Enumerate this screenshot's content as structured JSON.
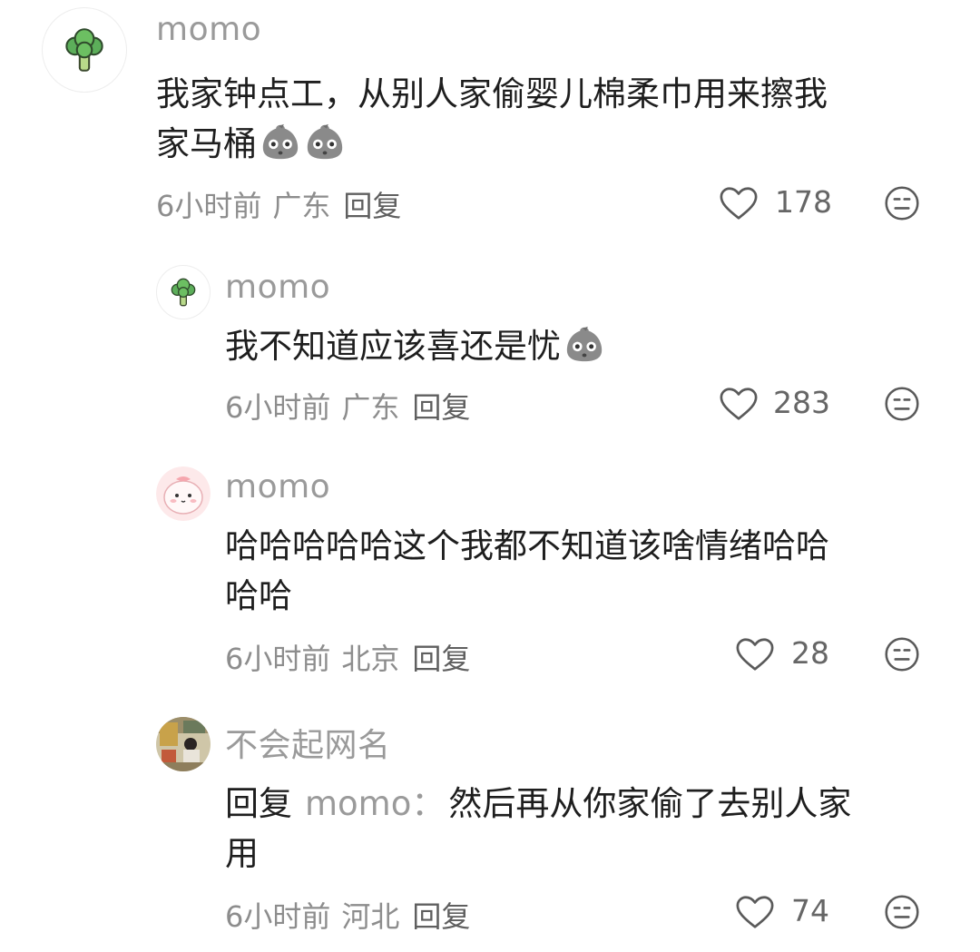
{
  "comments": [
    {
      "username": "momo",
      "avatar": "broccoli-avatar",
      "text_line1": "我家钟点工，从别人家偷婴儿棉柔巾用来擦我",
      "text_line2": "家马桶",
      "time": "6小时前",
      "location": "广东",
      "reply_label": "回复",
      "likes": "178"
    },
    {
      "username": "momo",
      "avatar": "broccoli-avatar",
      "text_line1": "我不知道应该喜还是忧",
      "time": "6小时前",
      "location": "广东",
      "reply_label": "回复",
      "likes": "283"
    },
    {
      "username": "momo",
      "avatar": "pink-character-avatar",
      "text_line1": "哈哈哈哈哈这个我都不知道该啥情绪哈哈",
      "text_line2": "哈哈",
      "time": "6小时前",
      "location": "北京",
      "reply_label": "回复",
      "likes": "28"
    },
    {
      "username": "不会起网名",
      "avatar": "photo-avatar",
      "reply_prefix": "回复",
      "reply_to": "momo：",
      "text_line1": "然后再从你家偷了去别人家",
      "text_line2": "用",
      "time": "6小时前",
      "location": "河北",
      "reply_label": "回复",
      "likes": "74"
    }
  ],
  "icons": {
    "like": "heart-outline-icon",
    "dislike": "neutral-face-icon",
    "inline_emoji": "gray-blob-emoji"
  },
  "colors": {
    "username": "#9a9a9a",
    "text": "#1e1e1e",
    "meta": "#8d8d8d"
  }
}
